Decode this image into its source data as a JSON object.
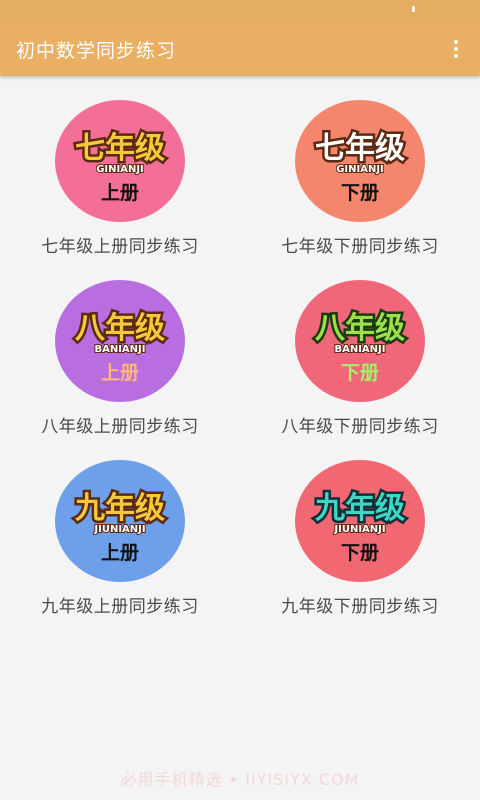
{
  "app": {
    "title": "初中数学同步练习",
    "menu_icon": "more-vert-icon"
  },
  "books": [
    {
      "grade": "七年级",
      "pinyin": "GINIANJI",
      "volume": "上册",
      "label": "七年级上册同步练习",
      "bg": "#f36f97",
      "grade_color": "#f7c93a",
      "vol_color": "#111111"
    },
    {
      "grade": "七年级",
      "pinyin": "GINIANJI",
      "volume": "下册",
      "label": "七年级下册同步练习",
      "bg": "#f4866e",
      "grade_color": "#ffffff",
      "vol_color": "#111111"
    },
    {
      "grade": "八年级",
      "pinyin": "BANIANJI",
      "volume": "上册",
      "label": "八年级上册同步练习",
      "bg": "#b86ee0",
      "grade_color": "#f7c93a",
      "vol_color": "#ffb77a"
    },
    {
      "grade": "八年级",
      "pinyin": "BANIANJI",
      "volume": "下册",
      "label": "八年级下册同步练习",
      "bg": "#f0677a",
      "grade_color": "#9be04a",
      "vol_color": "#a6f06a"
    },
    {
      "grade": "九年级",
      "pinyin": "JIUNIANJI",
      "volume": "上册",
      "label": "九年级上册同步练习",
      "bg": "#6d9fea",
      "grade_color": "#f7c93a",
      "vol_color": "#111111"
    },
    {
      "grade": "九年级",
      "pinyin": "JIUNIANJI",
      "volume": "下册",
      "label": "九年级下册同步练习",
      "bg": "#f26872",
      "grade_color": "#3fd6c2",
      "vol_color": "#111111"
    }
  ],
  "watermark": "必用手机精选 • IIYISIYX.COM"
}
